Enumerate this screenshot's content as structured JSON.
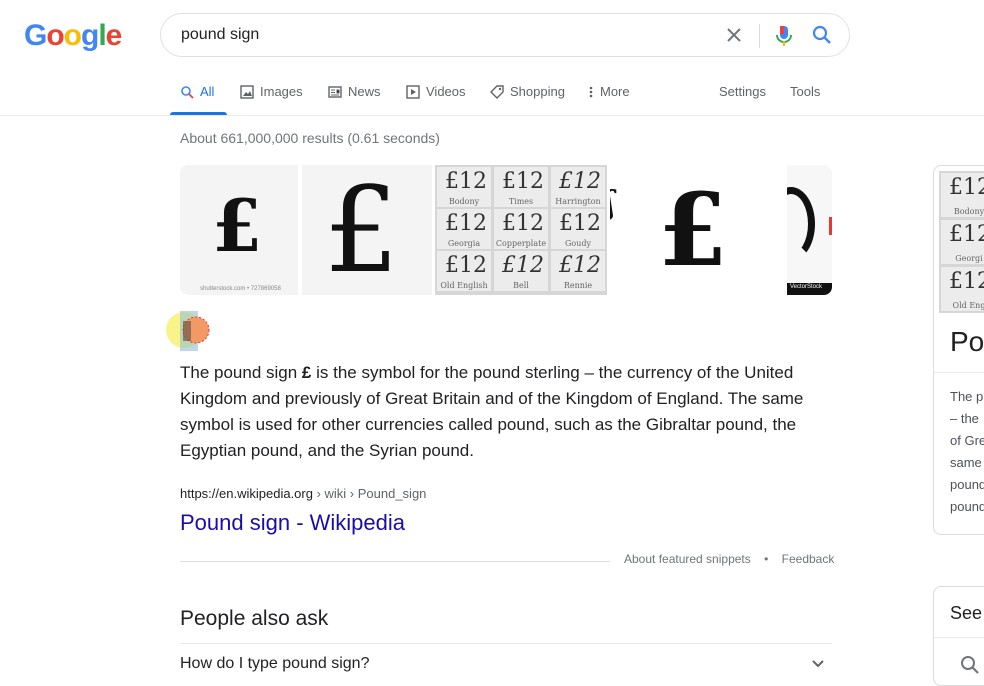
{
  "logo": {
    "letters": [
      "G",
      "o",
      "o",
      "g",
      "l",
      "e"
    ],
    "colors": [
      "#4285F4",
      "#EA4335",
      "#FBBC05",
      "#4285F4",
      "#34A853",
      "#EA4335"
    ]
  },
  "search": {
    "query": "pound sign"
  },
  "tabs": [
    {
      "label": "All",
      "icon": "search-icon",
      "active": true
    },
    {
      "label": "Images",
      "icon": "image-icon"
    },
    {
      "label": "News",
      "icon": "news-icon"
    },
    {
      "label": "Videos",
      "icon": "video-icon"
    },
    {
      "label": "Shopping",
      "icon": "tag-icon"
    },
    {
      "label": "More",
      "icon": "more-vert-icon"
    }
  ],
  "settings_label": "Settings",
  "tools_label": "Tools",
  "stats": "About 661,000,000 results (0.61 seconds)",
  "images": {
    "thumb1_glyph": "£",
    "thumb1_credit": "shutterstock.com • 727869058",
    "thumb2_glyph": "£",
    "grid_fonts": [
      "Bodony",
      "Times",
      "Harrington",
      "Georgia",
      "Copperplate",
      "Goudy",
      "Old English",
      "Bell",
      "Rennie"
    ],
    "grid_sample": "£12",
    "thumb4_glyph": "£",
    "thumb5_credit": "VectorStock"
  },
  "snippet": {
    "text_before": "The pound sign ",
    "symbol": "£",
    "text_after": " is the symbol for the pound sterling – the currency of the United Kingdom and previously of Great Britain and of the Kingdom of England. The same symbol is used for other currencies called pound, such as the Gibraltar pound, the Egyptian pound, and the Syrian pound."
  },
  "result": {
    "url_host": "https://en.wikipedia.org",
    "url_crumbs": " › wiki › Pound_sign",
    "title": "Pound sign - Wikipedia"
  },
  "featured_links": {
    "about": "About featured snippets",
    "sep": "•",
    "feedback": "Feedback"
  },
  "paa": {
    "title": "People also ask",
    "question1": "How do I type pound sign?"
  },
  "knowledge_panel": {
    "title": "Po",
    "lines": [
      "The p",
      "– the",
      "of Gre",
      "same",
      "pound",
      "pound"
    ],
    "grid_fonts": [
      "Bodony",
      "Georgi",
      "Old Eng"
    ]
  },
  "see_panel": {
    "title": "See"
  }
}
